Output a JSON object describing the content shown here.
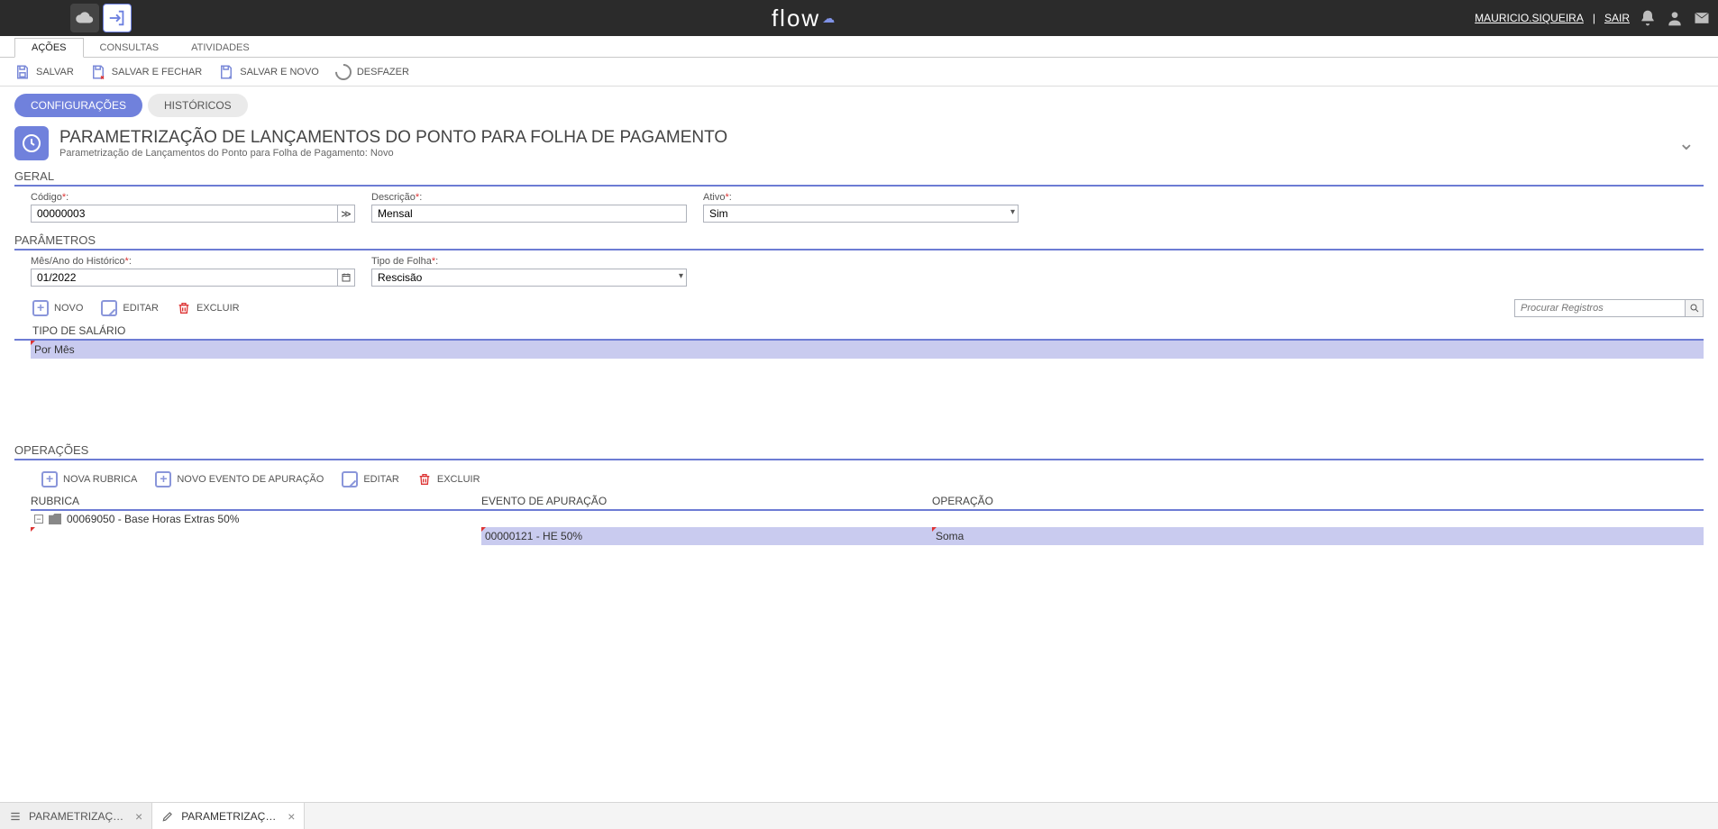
{
  "topbar": {
    "user": "MAURICIO.SIQUEIRA",
    "logout": "SAIR",
    "logo_text": "flow"
  },
  "ribbon_tabs": {
    "acoes": "AÇÕES",
    "consultas": "CONSULTAS",
    "atividades": "ATIVIDADES"
  },
  "ribbon_actions": {
    "salvar": "SALVAR",
    "salvar_fechar": "SALVAR E FECHAR",
    "salvar_novo": "SALVAR E NOVO",
    "desfazer": "DESFAZER"
  },
  "pill_tabs": {
    "config": "CONFIGURAÇÕES",
    "hist": "HISTÓRICOS"
  },
  "header": {
    "title": "PARAMETRIZAÇÃO DE LANÇAMENTOS DO PONTO PARA FOLHA DE PAGAMENTO",
    "subtitle": "Parametrização de Lançamentos do Ponto para Folha de Pagamento: Novo"
  },
  "sections": {
    "geral": "GERAL",
    "parametros": "PARÂMETROS",
    "tipo_salario": "TIPO DE SALÁRIO",
    "operacoes": "OPERAÇÕES"
  },
  "geral": {
    "codigo_label": "Código",
    "codigo_value": "00000003",
    "descricao_label": "Descrição",
    "descricao_value": "Mensal",
    "ativo_label": "Ativo",
    "ativo_value": "Sim"
  },
  "parametros": {
    "mesano_label": "Mês/Ano do Histórico",
    "mesano_value": "01/2022",
    "tipo_folha_label": "Tipo de Folha",
    "tipo_folha_value": "Rescisão"
  },
  "subgrid_toolbar": {
    "novo": "NOVO",
    "editar": "EDITAR",
    "excluir": "EXCLUIR",
    "search_placeholder": "Procurar Registros"
  },
  "tipo_salario_row": "Por Mês",
  "ops_toolbar": {
    "nova_rubrica": "NOVA RUBRICA",
    "novo_evento": "NOVO EVENTO DE APURAÇÃO",
    "editar": "EDITAR",
    "excluir": "EXCLUIR"
  },
  "ops_headers": {
    "rubrica": "RUBRICA",
    "evento": "EVENTO DE APURAÇÃO",
    "operacao": "OPERAÇÃO"
  },
  "ops_rows": {
    "rubrica_value": "00069050 - Base Horas Extras 50%",
    "evento_value": "00000121 - HE 50%",
    "operacao_value": "Soma"
  },
  "bottom_tabs": {
    "tab1": "PARAMETRIZAÇÃO DE LA...",
    "tab2": "PARAMETRIZAÇÃO DE ..."
  }
}
